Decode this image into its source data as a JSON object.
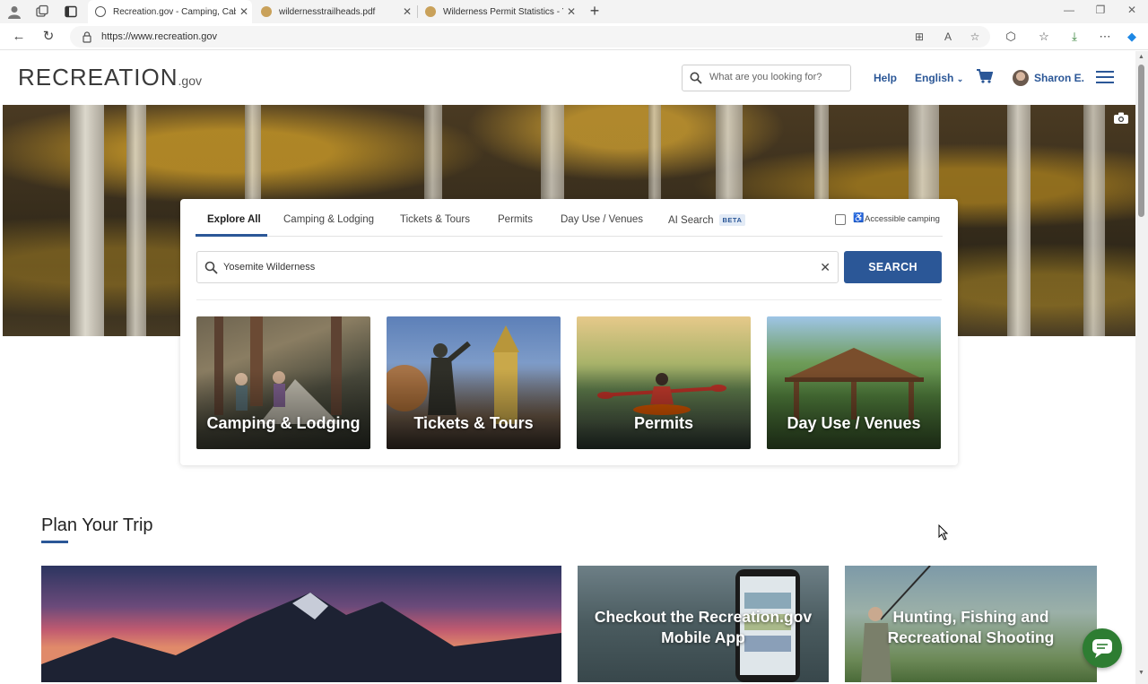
{
  "browser": {
    "tabs": [
      {
        "title": "Recreation.gov - Camping, Cabins",
        "active": true
      },
      {
        "title": "wildernesstrailheads.pdf",
        "active": false
      },
      {
        "title": "Wilderness Permit Statistics - Yosc",
        "active": false
      }
    ],
    "url": "https://www.recreation.gov"
  },
  "header": {
    "logo_main": "RECREATION",
    "logo_suffix": ".gov",
    "search_placeholder": "What are you looking for?",
    "help": "Help",
    "language": "English",
    "user_name": "Sharon E."
  },
  "search_panel": {
    "tabs": [
      {
        "label": "Explore All"
      },
      {
        "label": "Camping & Lodging"
      },
      {
        "label": "Tickets & Tours"
      },
      {
        "label": "Permits"
      },
      {
        "label": "Day Use / Venues"
      },
      {
        "label": "AI Search"
      }
    ],
    "beta_badge": "BETA",
    "accessible_label": "Accessible camping",
    "query": "Yosemite Wilderness",
    "search_button": "SEARCH",
    "cards": [
      {
        "label": "Camping & Lodging"
      },
      {
        "label": "Tickets & Tours"
      },
      {
        "label": "Permits"
      },
      {
        "label": "Day Use / Venues"
      }
    ]
  },
  "plan": {
    "title": "Plan Your Trip",
    "promos": [
      {
        "label": ""
      },
      {
        "label": "Checkout the Recreation.gov Mobile App"
      },
      {
        "label": "Hunting, Fishing and Recreational Shooting"
      }
    ]
  },
  "colors": {
    "accent": "#2b5797",
    "chat": "#2e7d32"
  },
  "icons": [
    "search-icon",
    "cart-icon",
    "menu-icon",
    "camera-icon",
    "chat-icon",
    "close-icon",
    "wheelchair-icon"
  ]
}
